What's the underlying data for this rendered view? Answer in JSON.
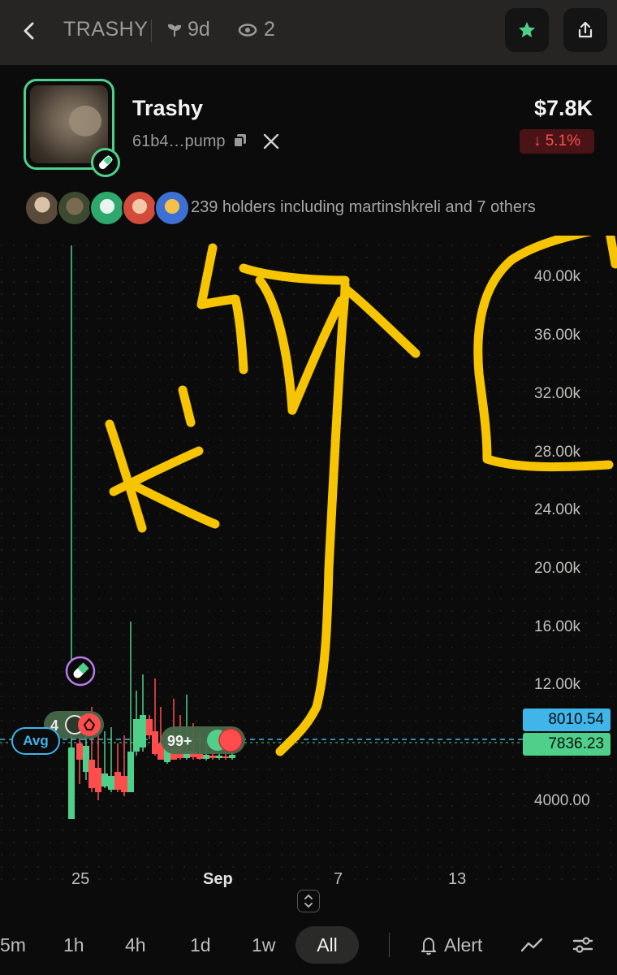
{
  "topbar": {
    "back_icon": "chevron-left-icon",
    "ticker": "TRASHY",
    "age": "9d",
    "age_icon": "sprout-icon",
    "watchers": "2",
    "watchers_icon": "eye-icon",
    "star_icon": "star-icon",
    "share_icon": "share-icon"
  },
  "token": {
    "name": "Trashy",
    "address": "61b4…pump",
    "price": "$7.8K",
    "change": "↓ 5.1%"
  },
  "holders": {
    "text": "239 holders including martinshkreli and 7 others"
  },
  "chart": {
    "annotations": [
      "Avg",
      "4",
      "99+"
    ],
    "price_tags": [
      "8010.54",
      "7836.23"
    ]
  },
  "chart_data": {
    "type": "line",
    "y_ticks": [
      "40.00k",
      "36.00k",
      "32.00k",
      "28.00k",
      "24.00k",
      "20.00k",
      "16.00k",
      "12.00k",
      "4000.00"
    ],
    "x_ticks": [
      "25",
      "Sep",
      "7",
      "13"
    ],
    "ylim": [
      2000,
      44000
    ],
    "current_price": 7836.23,
    "avg_price": 8010.54,
    "colors": {
      "up": "#4fd08a",
      "down": "#ff4d4d",
      "avg_line": "#3fb5ea",
      "annotation": "#f6c400"
    }
  },
  "timeframes": [
    "5m",
    "1h",
    "4h",
    "1d",
    "1w",
    "All"
  ],
  "selected_timeframe": "All",
  "alert_label": "Alert",
  "colors": {
    "accent_green": "#4fd08a",
    "negative": "#ff4d4d",
    "blue": "#3fb5ea"
  }
}
